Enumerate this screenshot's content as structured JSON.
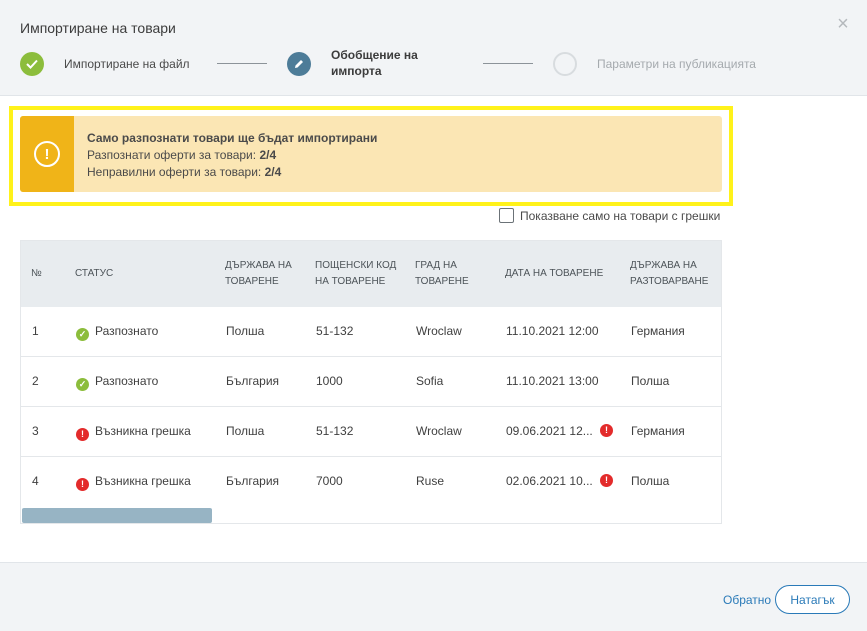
{
  "dialog": {
    "title": "Импортиране на товари",
    "close_icon": "close-icon"
  },
  "stepper": {
    "steps": [
      {
        "label": "Импортиране на файл",
        "state": "done",
        "icon": "check-icon"
      },
      {
        "label": "Обобщение на импорта",
        "state": "active",
        "icon": "pencil-icon"
      },
      {
        "label": "Параметри на публикацията",
        "state": "pending",
        "icon": "empty-circle-icon"
      }
    ]
  },
  "alert": {
    "title": "Само разпознати товари ще бъдат импортирани",
    "recognized_label": "Разпознати оферти за товари:",
    "recognized_value": "2/4",
    "invalid_label": "Неправилни оферти за товари:",
    "invalid_value": "2/4",
    "icon": "exclamation-icon",
    "color": "#f0b418"
  },
  "filter": {
    "label": "Показване само на товари с грешки",
    "checked": false
  },
  "table": {
    "columns": [
      "№",
      "СТАТУС",
      "ДЪРЖАВА НА ТОВАРЕНЕ",
      "ПОЩЕНСКИ КОД НА ТОВАРЕНЕ",
      "ГРАД НА ТОВАРЕНЕ",
      "ДАТА НА ТОВАРЕНЕ",
      "ДЪРЖАВА НА РАЗТОВАРВАНЕ"
    ],
    "rows": [
      {
        "num": "1",
        "status": "Разпознато",
        "status_type": "ok",
        "country": "Полша",
        "postal": "51-132",
        "city": "Wroclaw",
        "date": "11.10.2021 12:00",
        "unload_country": "Германия",
        "date_error": false
      },
      {
        "num": "2",
        "status": "Разпознато",
        "status_type": "ok",
        "country": "България",
        "postal": "1000",
        "city": "Sofia",
        "date": "11.10.2021 13:00",
        "unload_country": "Полша",
        "date_error": false
      },
      {
        "num": "3",
        "status": "Възникна грешка",
        "status_type": "error",
        "country": "Полша",
        "postal": "51-132",
        "city": "Wroclaw",
        "date": "09.06.2021 12...",
        "unload_country": "Германия",
        "date_error": true
      },
      {
        "num": "4",
        "status": "Възникна грешка",
        "status_type": "error",
        "country": "България",
        "postal": "7000",
        "city": "Ruse",
        "date": "02.06.2021 10...",
        "unload_country": "Полша",
        "date_error": true
      }
    ]
  },
  "footer": {
    "back_label": "Обратно",
    "next_label": "Натагък"
  },
  "colors": {
    "success": "#8cbd3c",
    "error": "#e32b2b",
    "active_step": "#4d7c98",
    "link": "#2a7ab8",
    "highlight_frame": "#fff21a"
  }
}
